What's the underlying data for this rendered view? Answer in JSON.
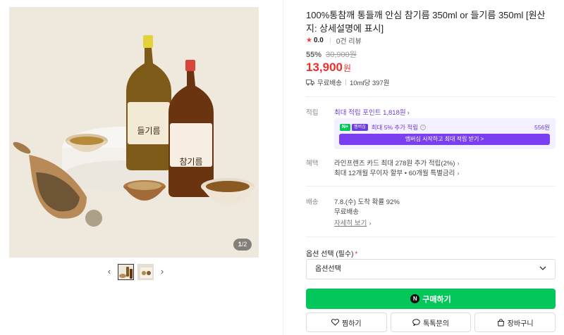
{
  "gallery": {
    "counter_current": "1",
    "counter_total": "/2",
    "prev_arrow": "‹",
    "next_arrow": "›",
    "bottle_left_label": "들기름",
    "bottle_right_label": "참기름"
  },
  "product": {
    "title": "100%통참깨 통들깨 안심 참기름 350ml or 들기름 350ml [원산지: 상세설명에 표시]",
    "rating_score": "0.0",
    "review_count": "0건 리뷰",
    "discount": "55%",
    "original_price": "30,900원",
    "sale_price": "13,900",
    "sale_currency": "원",
    "shipping": "무료배송",
    "unit_price": "10ml당 397원"
  },
  "points": {
    "label": "적립",
    "max_points": "최대 적립 포인트 1,818원",
    "membership_extra": "최대 5% 추가 적립",
    "n_badge": "N+",
    "mem_badge": "멤버십",
    "membership_amount": "556원",
    "membership_button": "멤버십 시작하고 최대 적립 받기 >"
  },
  "benefits": {
    "label": "혜택",
    "line1": "라인프렌즈 카드 최대 278원 추가 적립(2%)",
    "line2": "최대 12개월 무이자 할부 • 60개월 특별금리"
  },
  "delivery": {
    "label": "배송",
    "arrival": "7.8.(수) 도착 확률 92%",
    "fee": "무료배송",
    "detail_link": "자세히 보기"
  },
  "option": {
    "label": "옵션 선택 (필수)",
    "required_mark": "*",
    "select_value": "옵션선택"
  },
  "actions": {
    "buy": "구매하기",
    "npay_icon": "N",
    "wish": "찜하기",
    "talk": "톡톡문의",
    "cart": "장바구니"
  },
  "colors": {
    "accent_green": "#03c75a",
    "price_red": "#ef2d2d",
    "membership_purple": "#7a3ff0"
  },
  "icons": [
    "star-icon",
    "truck-icon",
    "info-icon",
    "chevron-down-icon",
    "heart-icon",
    "chat-icon",
    "cart-icon"
  ]
}
